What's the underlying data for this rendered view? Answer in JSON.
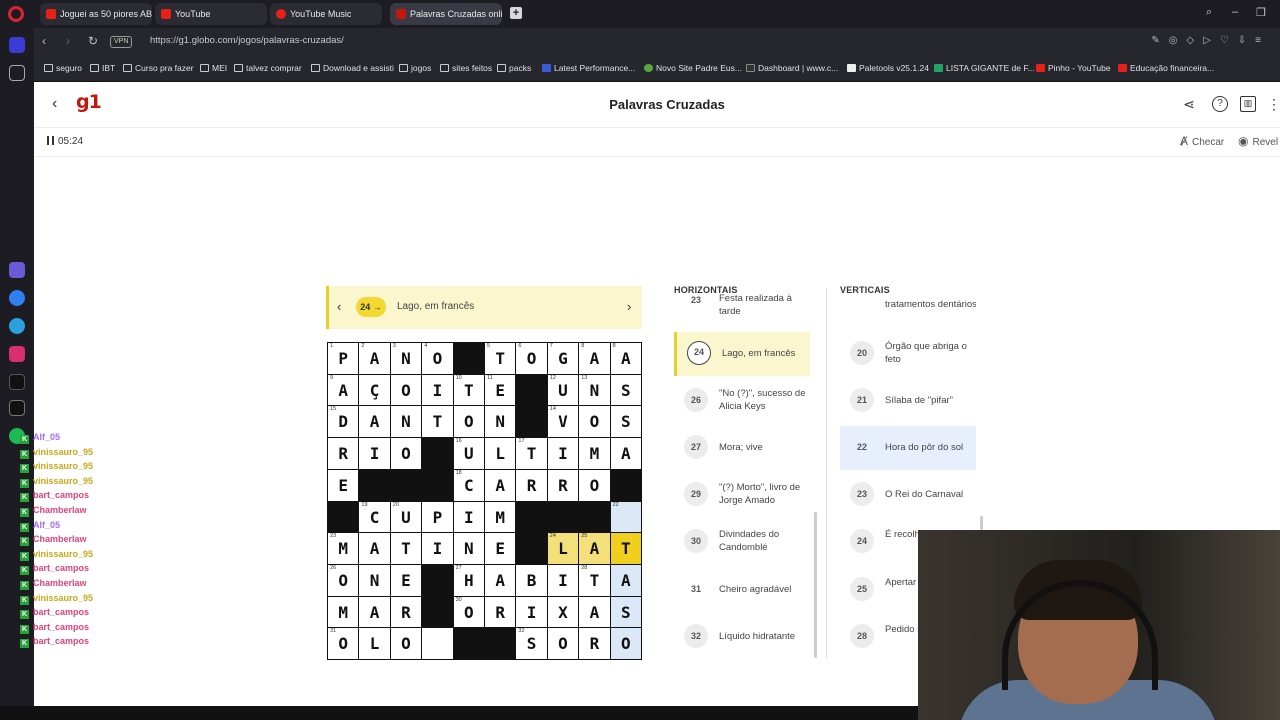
{
  "browser": {
    "tabs": [
      {
        "label": "Joguei as 50 piores ABERT",
        "favicon_color": "#e62117"
      },
      {
        "label": "YouTube",
        "favicon_color": "#e62117"
      },
      {
        "label": "YouTube Music",
        "favicon_color": "#e62117"
      },
      {
        "label": "Palavras Cruzadas online:",
        "favicon_color": "#c4170c"
      }
    ],
    "new_tab": "+",
    "url": "https://g1.globo.com/jogos/palavras-cruzadas/",
    "vpn_label": "VPN",
    "bookmarks": [
      "seguro",
      "IBT",
      "Curso pra fazer",
      "MEI",
      "talvez comprar",
      "Download e assisti",
      "jogos",
      "sites feitos",
      "packs",
      "Latest Performance...",
      "Novo Site Padre Eus...",
      "Dashboard | www.c...",
      "Paletools v25.1.24",
      "LISTA GIGANTE de F...",
      "Pinho - YouTube",
      "Educação financeira..."
    ]
  },
  "header": {
    "logo": "g1",
    "title": "Palavras Cruzadas"
  },
  "toolbar": {
    "timer": "05:24",
    "check_label": "Checar",
    "reveal_label": "Revel"
  },
  "current_clue": {
    "number": "24",
    "text": "Lago, em francês"
  },
  "grid": {
    "rows": [
      [
        "1:P",
        "2:A",
        "3:N",
        "4:O",
        "#",
        "5:T",
        "6:O",
        "7:G",
        "8:A"
      ],
      [
        "9:A",
        "Ç",
        "O",
        "I",
        "10:T",
        "11:E",
        "#",
        "12:U",
        "13:N",
        "S"
      ],
      [
        "15:D",
        "A",
        "N",
        "T",
        "O",
        "N",
        "#",
        "14:V",
        "O",
        "S"
      ],
      [
        "R",
        "I",
        "O",
        "#",
        "16:U",
        "L",
        "17:T",
        "I",
        "M",
        "A"
      ],
      [
        "E",
        "#",
        "#",
        "#",
        "18:C",
        "A",
        "R",
        "R",
        "O",
        "#"
      ],
      [
        "#",
        "19:C",
        "20:U",
        "P",
        "I",
        "M",
        "#",
        "#",
        "#",
        "22:"
      ],
      [
        "23:M",
        "A",
        "T",
        "I",
        "N",
        "E",
        "#",
        "24:L",
        "25:A",
        "T"
      ],
      [
        "26:O",
        "N",
        "E",
        "#",
        "27:H",
        "A",
        "B",
        "I",
        "28:T",
        "A"
      ],
      [
        "M",
        "A",
        "R",
        "#",
        "30:O",
        "R",
        "I",
        "X",
        "A",
        "S"
      ],
      [
        "31:O",
        "L",
        "O",
        "",
        "#",
        "#",
        "32:S",
        "O",
        "R",
        "O"
      ]
    ]
  },
  "clues": {
    "across_title": "HORIZONTAIS",
    "down_title": "VERTICAIS",
    "across": [
      {
        "num": "23",
        "text": "Festa realizada à tarde"
      },
      {
        "num": "24",
        "text": "Lago, em francês"
      },
      {
        "num": "26",
        "text": "\"No (?)\", sucesso de Alicia Keys"
      },
      {
        "num": "27",
        "text": "Mora; vive"
      },
      {
        "num": "29",
        "text": "\"(?) Morto\", livro de Jorge Amado"
      },
      {
        "num": "30",
        "text": "Divindades do Candomblé"
      },
      {
        "num": "31",
        "text": "Cheiro agradável"
      },
      {
        "num": "32",
        "text": "Líquido hidratante"
      }
    ],
    "down": [
      {
        "num": "",
        "text": "tratamentos dentários"
      },
      {
        "num": "20",
        "text": "Órgão que abriga o feto"
      },
      {
        "num": "21",
        "text": "Sílaba de \"pifar\""
      },
      {
        "num": "22",
        "text": "Hora do pôr do sol"
      },
      {
        "num": "23",
        "text": "O Rei do Carnaval"
      },
      {
        "num": "24",
        "text": "É recolh gari"
      },
      {
        "num": "25",
        "text": "Apertar laçada c"
      },
      {
        "num": "28",
        "text": "Pedido show de"
      }
    ]
  },
  "chat": [
    {
      "user": "Alf_05",
      "color": "#a06bff"
    },
    {
      "user": "vinissauro_95",
      "color": "#c8a91c"
    },
    {
      "user": "vinissauro_95",
      "color": "#c8a91c"
    },
    {
      "user": "vinissauro_95",
      "color": "#c8a91c"
    },
    {
      "user": "bart_campos",
      "color": "#e0437a"
    },
    {
      "user": "Chamberlaw",
      "color": "#e0437a"
    },
    {
      "user": "Alf_05",
      "color": "#a06bff"
    },
    {
      "user": "Chamberlaw",
      "color": "#e0437a"
    },
    {
      "user": "vinissauro_95",
      "color": "#c8a91c"
    },
    {
      "user": "bart_campos",
      "color": "#e0437a"
    },
    {
      "user": "Chamberlaw",
      "color": "#e0437a"
    },
    {
      "user": "vinissauro_95",
      "color": "#c8a91c"
    },
    {
      "user": "bart_campos",
      "color": "#e0437a"
    },
    {
      "user": "bart_campos",
      "color": "#e0437a"
    },
    {
      "user": "bart_campos",
      "color": "#e0437a"
    }
  ]
}
